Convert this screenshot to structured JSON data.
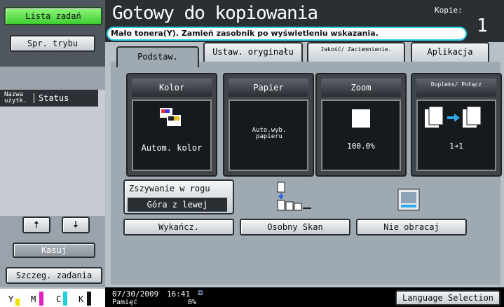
{
  "sidebar": {
    "job_list_label": "Lista zadań",
    "check_mode_label": "Spr. trybu",
    "user_col": "Nazwa użytk.",
    "status_col": "Status",
    "delete_label": "Kasuj",
    "job_details_label": "Szczeg. zadania",
    "toner": [
      "Y",
      "M",
      "C",
      "K"
    ]
  },
  "header": {
    "title": "Gotowy do kopiowania",
    "copies_label": "Kopie:",
    "copies_value": "1",
    "message": "Mało tonera(Y). Zamień zasobnik po wyświetleniu wskazania."
  },
  "tabs": [
    {
      "label": "Podstaw."
    },
    {
      "label": "Ustaw. oryginału"
    },
    {
      "label": "Jakość/ Zaciemnienie."
    },
    {
      "label": "Aplikacja"
    }
  ],
  "functions": {
    "color": {
      "title": "Kolor",
      "value": "Autom. kolor"
    },
    "paper": {
      "title": "Papier",
      "value": "Auto.wyb. papieru"
    },
    "zoom": {
      "title": "Zoom",
      "value": "100.0%"
    },
    "duplex": {
      "title": "Dupleks/ Połącz",
      "value": "1➔1"
    }
  },
  "staple": {
    "label": "Zszywanie w rogu",
    "value": "Góra z lewej"
  },
  "buttons": {
    "finish": "Wykańcz.",
    "separate_scan": "Osobny Skan",
    "no_rotate": "Nie obracaj"
  },
  "status_bar": {
    "date": "07/30/2009",
    "time": "16:41",
    "memory_label": "Pamięć",
    "memory_value": "0%",
    "language": "Language Selection"
  }
}
